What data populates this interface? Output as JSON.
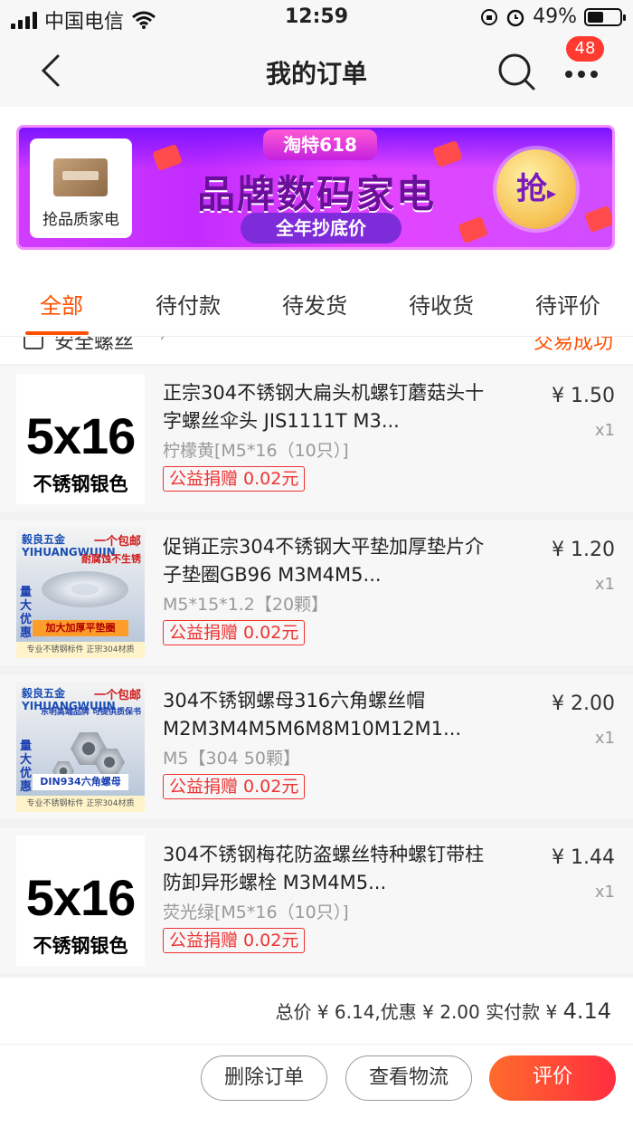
{
  "status_bar": {
    "carrier": "中国电信",
    "time": "12:59",
    "battery_percent": "49%",
    "battery_level": 0.49
  },
  "nav": {
    "title": "我的订单",
    "badge_count": "48"
  },
  "banner": {
    "card_label": "抢品质家电",
    "tag": "淘特618",
    "headline": "品牌数码家电",
    "subline": "全年抄底价",
    "grab": "抢"
  },
  "tabs": [
    {
      "label": "全部",
      "active": true
    },
    {
      "label": "待付款",
      "active": false
    },
    {
      "label": "待发货",
      "active": false
    },
    {
      "label": "待收货",
      "active": false
    },
    {
      "label": "待评价",
      "active": false
    }
  ],
  "store": {
    "name": "安全螺丝",
    "status": "交易成功"
  },
  "items": [
    {
      "title": "正宗304不锈钢大扁头机螺钉蘑菇头十字螺丝伞头 JIS1111T M3...",
      "sku": "柠檬黄[M5*16（10只）]",
      "charity": "公益捐赠 0.02元",
      "price": "¥ 1.50",
      "qty": "x1",
      "thumb_big": "5x16",
      "thumb_small": "不锈钢银色"
    },
    {
      "title": "促销正宗304不锈钢大平垫加厚垫片介子垫圈GB96 M3M4M5...",
      "sku": "M5*15*1.2【20颗】",
      "charity": "公益捐赠 0.02元",
      "price": "¥ 1.20",
      "qty": "x1",
      "thumb_brand": "毅良五金 YIHUANGWUJIN",
      "thumb_promo": "一个包邮",
      "thumb_feature": "耐腐蚀不生锈",
      "thumb_side": "量大优惠",
      "thumb_bottom": "加大加厚平垫圈",
      "thumb_foot": "专业不锈钢标件 正宗304材质"
    },
    {
      "title": "304不锈钢螺母316六角螺丝帽 M2M3M4M5M6M8M10M12M1...",
      "sku": "M5【304 50颗】",
      "charity": "公益捐赠 0.02元",
      "price": "¥ 2.00",
      "qty": "x1",
      "thumb_brand": "毅良五金 YIHUANGWUJIN",
      "thumb_promo": "一个包邮",
      "thumb_feature": "东明高端品牌 可提供质保书",
      "thumb_side": "量大优惠",
      "thumb_bottom": "DIN934六角螺母",
      "thumb_foot": "专业不锈钢标件 正宗304材质"
    },
    {
      "title": "304不锈钢梅花防盗螺丝特种螺钉带柱防卸异形螺栓 M3M4M5...",
      "sku": "荧光绿[M5*16（10只）]",
      "charity": "公益捐赠 0.02元",
      "price": "¥ 1.44",
      "qty": "x1",
      "thumb_big": "5x16",
      "thumb_small": "不锈钢银色"
    }
  ],
  "totals": {
    "label": "总价 ¥ 6.14,优惠 ¥ 2.00 实付款 ¥ ",
    "amount": "4.14"
  },
  "actions": {
    "delete": "删除订单",
    "logistics": "查看物流",
    "review": "评价"
  },
  "colors": {
    "accent": "#ff5000",
    "charity_red": "#e33333",
    "banner_purple": "#c22cff"
  }
}
